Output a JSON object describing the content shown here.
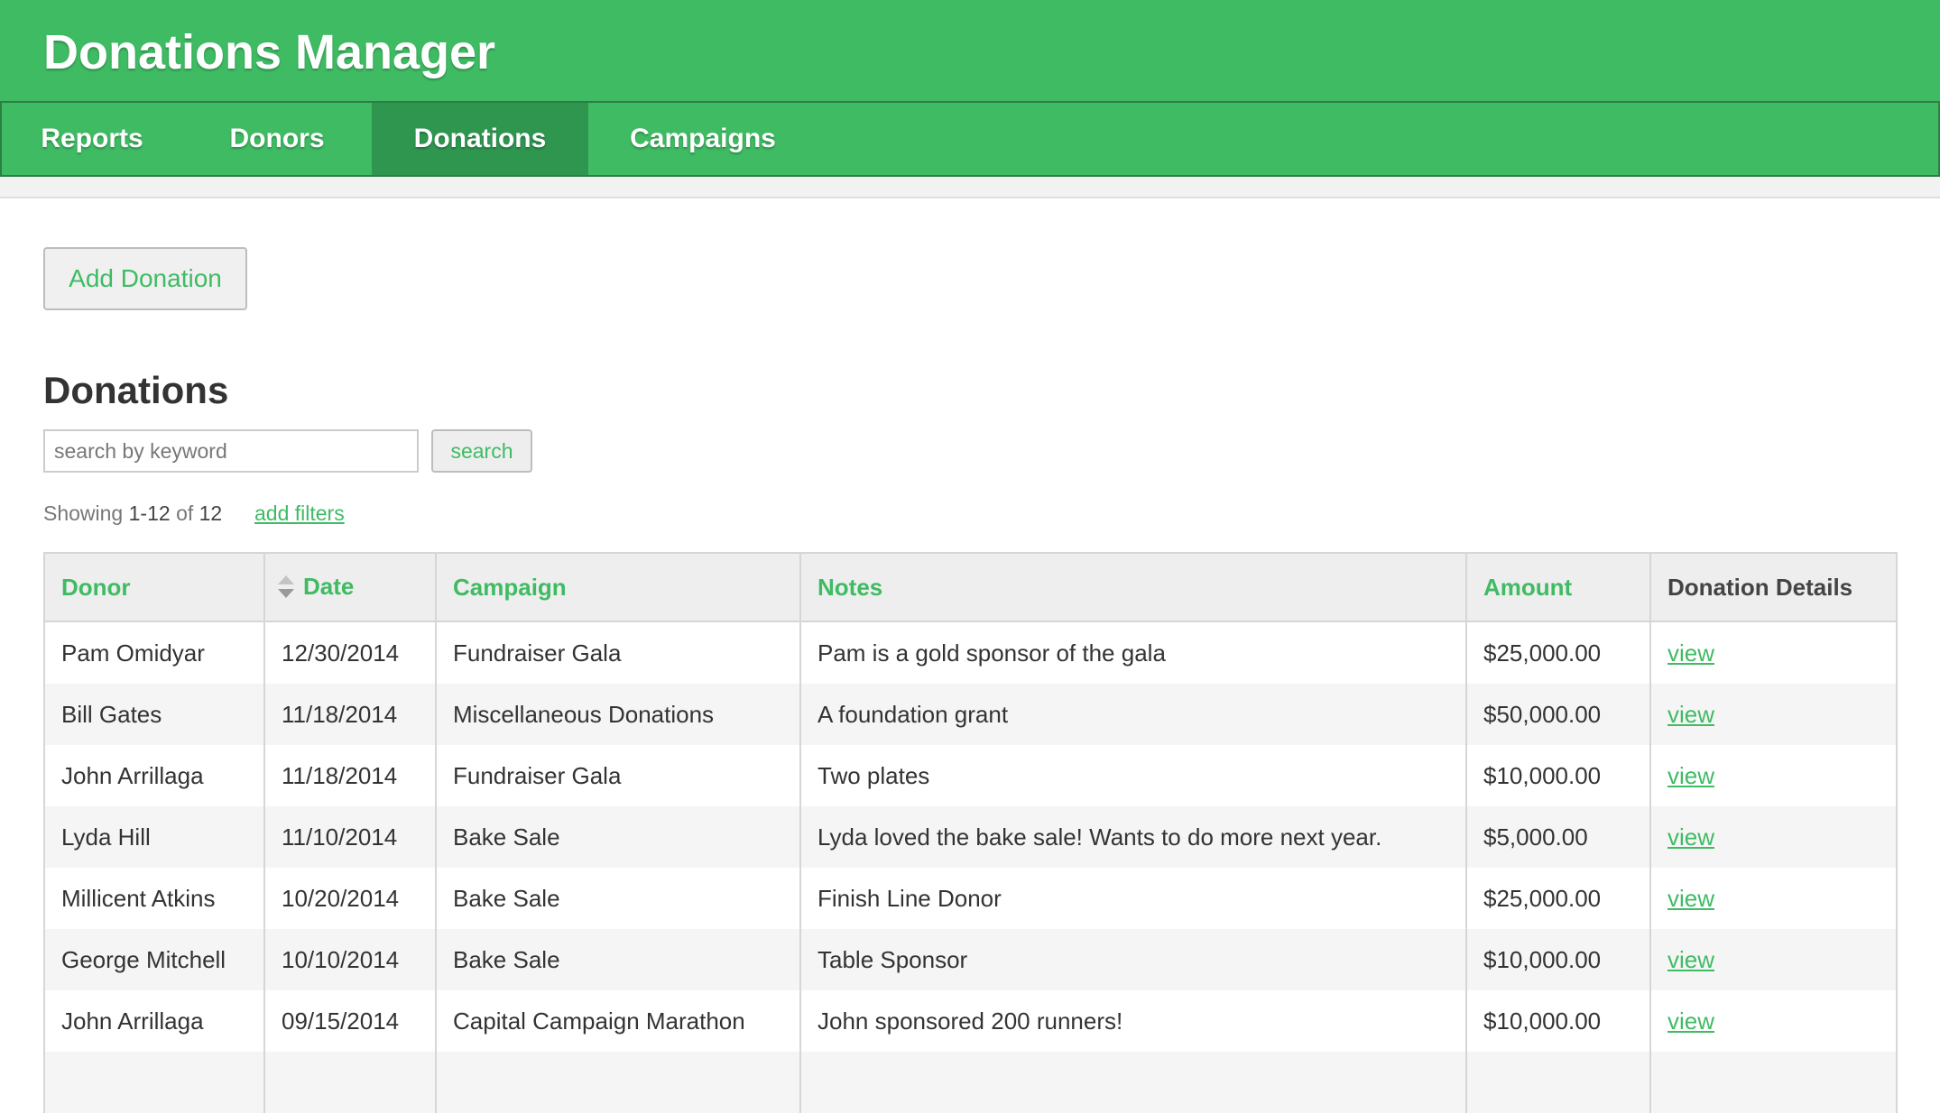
{
  "app": {
    "title": "Donations Manager"
  },
  "nav": {
    "items": [
      {
        "label": "Reports",
        "active": false
      },
      {
        "label": "Donors",
        "active": false
      },
      {
        "label": "Donations",
        "active": true
      },
      {
        "label": "Campaigns",
        "active": false
      }
    ]
  },
  "toolbar": {
    "add_label": "Add Donation"
  },
  "section": {
    "title": "Donations"
  },
  "search": {
    "placeholder": "search by keyword",
    "value": "",
    "button_label": "search"
  },
  "results": {
    "showing_prefix": "Showing",
    "range": "1-12",
    "of_word": "of",
    "total": "12",
    "filters_link": "add filters"
  },
  "table": {
    "columns": [
      {
        "label": "Donor",
        "sortable": true
      },
      {
        "label": "Date",
        "sortable": true,
        "sort_icon": "sort-arrows-icon"
      },
      {
        "label": "Campaign",
        "sortable": true
      },
      {
        "label": "Notes",
        "sortable": true
      },
      {
        "label": "Amount",
        "sortable": true
      },
      {
        "label": "Donation Details",
        "sortable": false
      }
    ],
    "rows": [
      {
        "donor": "Pam Omidyar",
        "date": "12/30/2014",
        "campaign": "Fundraiser Gala",
        "notes": "Pam is a gold sponsor of the gala",
        "amount": "$25,000.00",
        "link": "view"
      },
      {
        "donor": "Bill Gates",
        "date": "11/18/2014",
        "campaign": "Miscellaneous Donations",
        "notes": "A foundation grant",
        "amount": "$50,000.00",
        "link": "view"
      },
      {
        "donor": "John Arrillaga",
        "date": "11/18/2014",
        "campaign": "Fundraiser Gala",
        "notes": "Two plates",
        "amount": "$10,000.00",
        "link": "view"
      },
      {
        "donor": "Lyda Hill",
        "date": "11/10/2014",
        "campaign": "Bake Sale",
        "notes": "Lyda loved the bake sale! Wants to do more next year.",
        "amount": "$5,000.00",
        "link": "view"
      },
      {
        "donor": "Millicent Atkins",
        "date": "10/20/2014",
        "campaign": "Bake Sale",
        "notes": "Finish Line Donor",
        "amount": "$25,000.00",
        "link": "view"
      },
      {
        "donor": "George Mitchell",
        "date": "10/10/2014",
        "campaign": "Bake Sale",
        "notes": "Table Sponsor",
        "amount": "$10,000.00",
        "link": "view"
      },
      {
        "donor": "John Arrillaga",
        "date": "09/15/2014",
        "campaign": "Capital Campaign Marathon",
        "notes": "John sponsored 200 runners!",
        "amount": "$10,000.00",
        "link": "view"
      }
    ]
  },
  "colors": {
    "brand_green": "#3fbb63",
    "active_tab": "#2f9650",
    "nav_border": "#2d7e45"
  }
}
